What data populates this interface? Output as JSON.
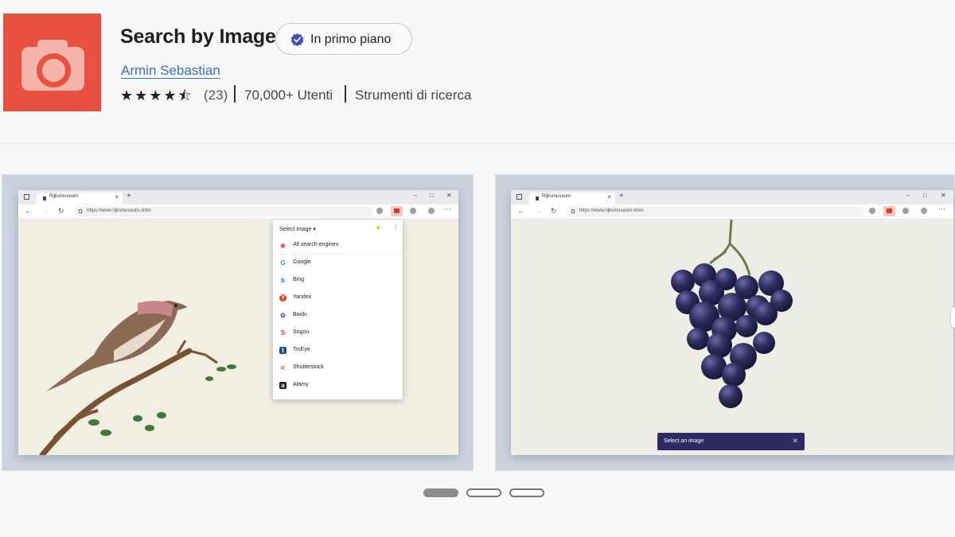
{
  "extension": {
    "title": "Search by Image",
    "badge": "In primo piano",
    "author": "Armin Sebastian",
    "rating": 4.5,
    "stars": "★★★★⯪",
    "rating_count": "(23)",
    "users": "70,000+ Utenti",
    "category": "Strumenti di ricerca",
    "icon": "camera-icon",
    "icon_color": "#e8503f"
  },
  "screenshot1": {
    "tab_title": "Rijksmuseum",
    "url": "https://www.rijksmuseum.nl/en",
    "popup": {
      "select_label": "Select image",
      "items": [
        {
          "name": "All search engines",
          "icon": "globe-icon",
          "color": "#d93b2b"
        },
        {
          "name": "Google",
          "icon": "google-icon",
          "color": "#4285f4"
        },
        {
          "name": "Bing",
          "icon": "bing-icon",
          "color": "#1a73e8"
        },
        {
          "name": "Yandex",
          "icon": "yandex-icon",
          "color": "#e2401c"
        },
        {
          "name": "Baidu",
          "icon": "baidu-icon",
          "color": "#2932e1"
        },
        {
          "name": "Sogou",
          "icon": "sogou-icon",
          "color": "#e4393c"
        },
        {
          "name": "TinEye",
          "icon": "tineye-icon",
          "color": "#1f4f7a"
        },
        {
          "name": "Shutterstock",
          "icon": "shutterstock-icon",
          "color": "#ee2b24"
        },
        {
          "name": "Alamy",
          "icon": "alamy-icon",
          "color": "#222222"
        }
      ]
    }
  },
  "screenshot2": {
    "tab_title": "Rijksmuseum",
    "url": "https://www.rijksmuseum.nl/en",
    "toast": "Select an image"
  },
  "carousel": {
    "pages": 3,
    "active_page": 1
  }
}
